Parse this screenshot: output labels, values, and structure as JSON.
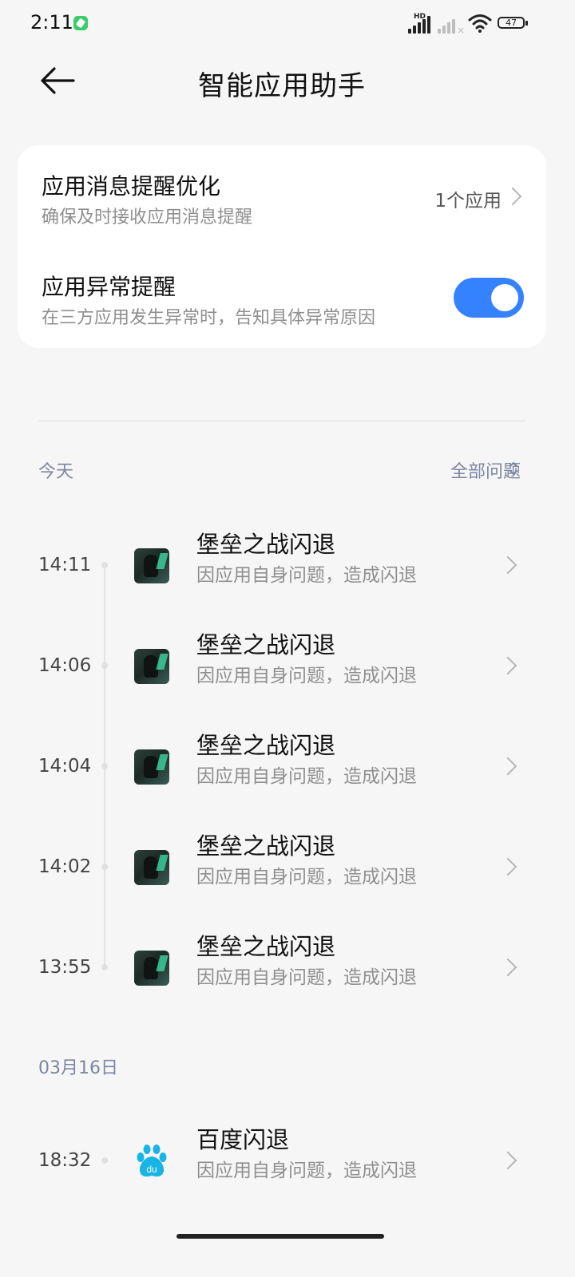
{
  "status_bar": {
    "time": "2:11",
    "hd_label": "HD",
    "battery": "47"
  },
  "header": {
    "title": "智能应用助手"
  },
  "settings": {
    "notify_opt": {
      "title": "应用消息提醒优化",
      "subtitle": "确保及时接收应用消息提醒",
      "value": "1个应用"
    },
    "anomaly": {
      "title": "应用异常提醒",
      "subtitle": "在三方应用发生异常时，告知具体异常原因",
      "enabled": true
    }
  },
  "filter": {
    "label": "全部问题"
  },
  "sections": [
    {
      "date": "今天",
      "items": [
        {
          "time": "14:11",
          "title": "堡垒之战闪退",
          "subtitle": "因应用自身问题，造成闪退",
          "icon": "game-icon"
        },
        {
          "time": "14:06",
          "title": "堡垒之战闪退",
          "subtitle": "因应用自身问题，造成闪退",
          "icon": "game-icon"
        },
        {
          "time": "14:04",
          "title": "堡垒之战闪退",
          "subtitle": "因应用自身问题，造成闪退",
          "icon": "game-icon"
        },
        {
          "time": "14:02",
          "title": "堡垒之战闪退",
          "subtitle": "因应用自身问题，造成闪退",
          "icon": "game-icon"
        },
        {
          "time": "13:55",
          "title": "堡垒之战闪退",
          "subtitle": "因应用自身问题，造成闪退",
          "icon": "game-icon"
        }
      ]
    },
    {
      "date": "03月16日",
      "items": [
        {
          "time": "18:32",
          "title": "百度闪退",
          "subtitle": "因应用自身问题，造成闪退",
          "icon": "baidu-icon"
        }
      ]
    }
  ],
  "colors": {
    "accent": "#3482ff",
    "background": "#f6f6f6",
    "muted_text": "#8f8f8f",
    "section_text": "#7c86a2",
    "baidu_blue": "#19b4e6"
  }
}
